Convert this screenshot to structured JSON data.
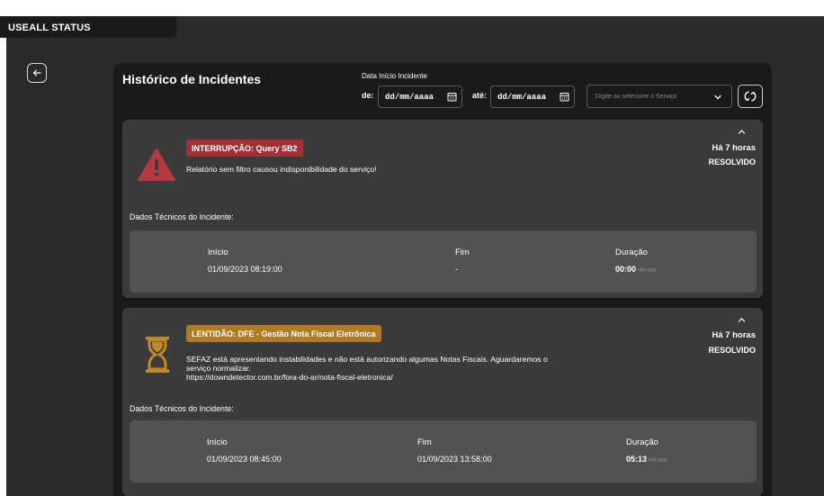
{
  "app": {
    "title": "USEALL STATUS"
  },
  "page": {
    "title": "Histórico de Incidentes"
  },
  "filters": {
    "date_caption": "Data Início Incidente",
    "from_label": "de:",
    "from_value": "dd/mm/aaaa",
    "to_label": "até:",
    "to_value": "dd/mm/aaaa",
    "service_placeholder": "Digite ou selecione o Serviço"
  },
  "incidents": [
    {
      "badge": "INTERRUPÇÃO: Query SB2",
      "description": "Relatório sem filtro causou indisponibilidade do serviço!",
      "ago": "Há 7 horas",
      "status": "RESOLVIDO",
      "tech_label": "Dados Técnicos do Incidente:",
      "start_label": "Início",
      "start_value": "01/09/2023 08:19:00",
      "end_label": "Fim",
      "end_value": "-",
      "duration_label": "Duração",
      "duration_value": "00:00",
      "duration_unit": "HH:mm",
      "color": "#a33037"
    },
    {
      "badge": "LENTIDÃO: DFE - Gestão Nota Fiscal Eletrônica",
      "description_line1": "SEFAZ está apresentando instabilidades e não está autorizando algumas Notas Fiscais. Aguardaremos o",
      "description_line2": "serviço normalizar.",
      "description_line3": "https://downdetector.com.br/fora-do-ar/nota-fiscal-eletronica/",
      "ago": "Há 7 horas",
      "status": "RESOLVIDO",
      "tech_label": "Dados Técnicos do Incidente:",
      "start_label": "Início",
      "start_value": "01/09/2023 08:45:00",
      "end_label": "Fim",
      "end_value": "01/09/2023 13:58:00",
      "duration_label": "Duração",
      "duration_value": "05:13",
      "duration_unit": "HH:mm",
      "color": "#b07b24"
    }
  ],
  "icons": {
    "back": "arrow-left-icon",
    "calendar": "calendar-icon",
    "chevron": "chevron-down-icon",
    "refresh": "refresh-icon",
    "collapse": "chevron-up-icon",
    "warning": "warning-icon",
    "hourglass": "hourglass-icon"
  }
}
